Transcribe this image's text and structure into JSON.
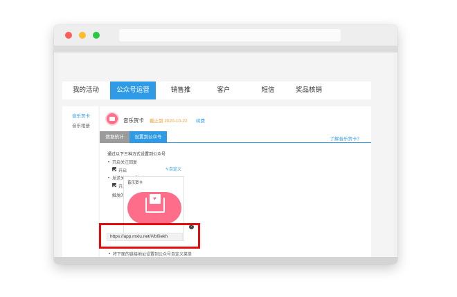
{
  "window": {
    "controls": {
      "close_color": "#fb5f57",
      "minimize_color": "#fcbc2e",
      "maximize_color": "#2ac940"
    }
  },
  "nav": {
    "tabs": [
      {
        "label": "我的活动",
        "active": false
      },
      {
        "label": "公众号运营",
        "active": true
      },
      {
        "label": "销售推",
        "active": false
      },
      {
        "label": "客户",
        "active": false
      },
      {
        "label": "短信",
        "active": false
      },
      {
        "label": "奖品核销",
        "active": false
      }
    ]
  },
  "sidebar": {
    "items": [
      {
        "label": "音乐贺卡",
        "active": true
      },
      {
        "label": "音乐相册",
        "active": false
      }
    ]
  },
  "card": {
    "icon": "envelope-heart-icon",
    "title": "音乐贺卡",
    "deadline": "截止到 2020-10-22",
    "renew": "续费"
  },
  "subtabs": {
    "stats": "数据统计",
    "settings": "设置到公众号",
    "learn_more": "了解音乐贺卡？"
  },
  "settings": {
    "intro": "通过以下三种方式设置到公众号",
    "option1_label": "开启关注回复",
    "option1_toggle": "开启",
    "option2_label": "发送关键词「贺卡」",
    "option2_toggle": "开启",
    "style_label": "触发的图文样式",
    "custom_link": "自定义",
    "preview_title": "音乐贺卡",
    "option3_label": "将下面的链接地址设置到公众号自定义菜单",
    "link_value": "https://app.mxiu.net/#/b0iekh"
  },
  "colors": {
    "accent": "#2f9be6",
    "deadline": "#f29a2e",
    "highlight": "#e30b0b",
    "card_pink": "#fe6d89"
  }
}
